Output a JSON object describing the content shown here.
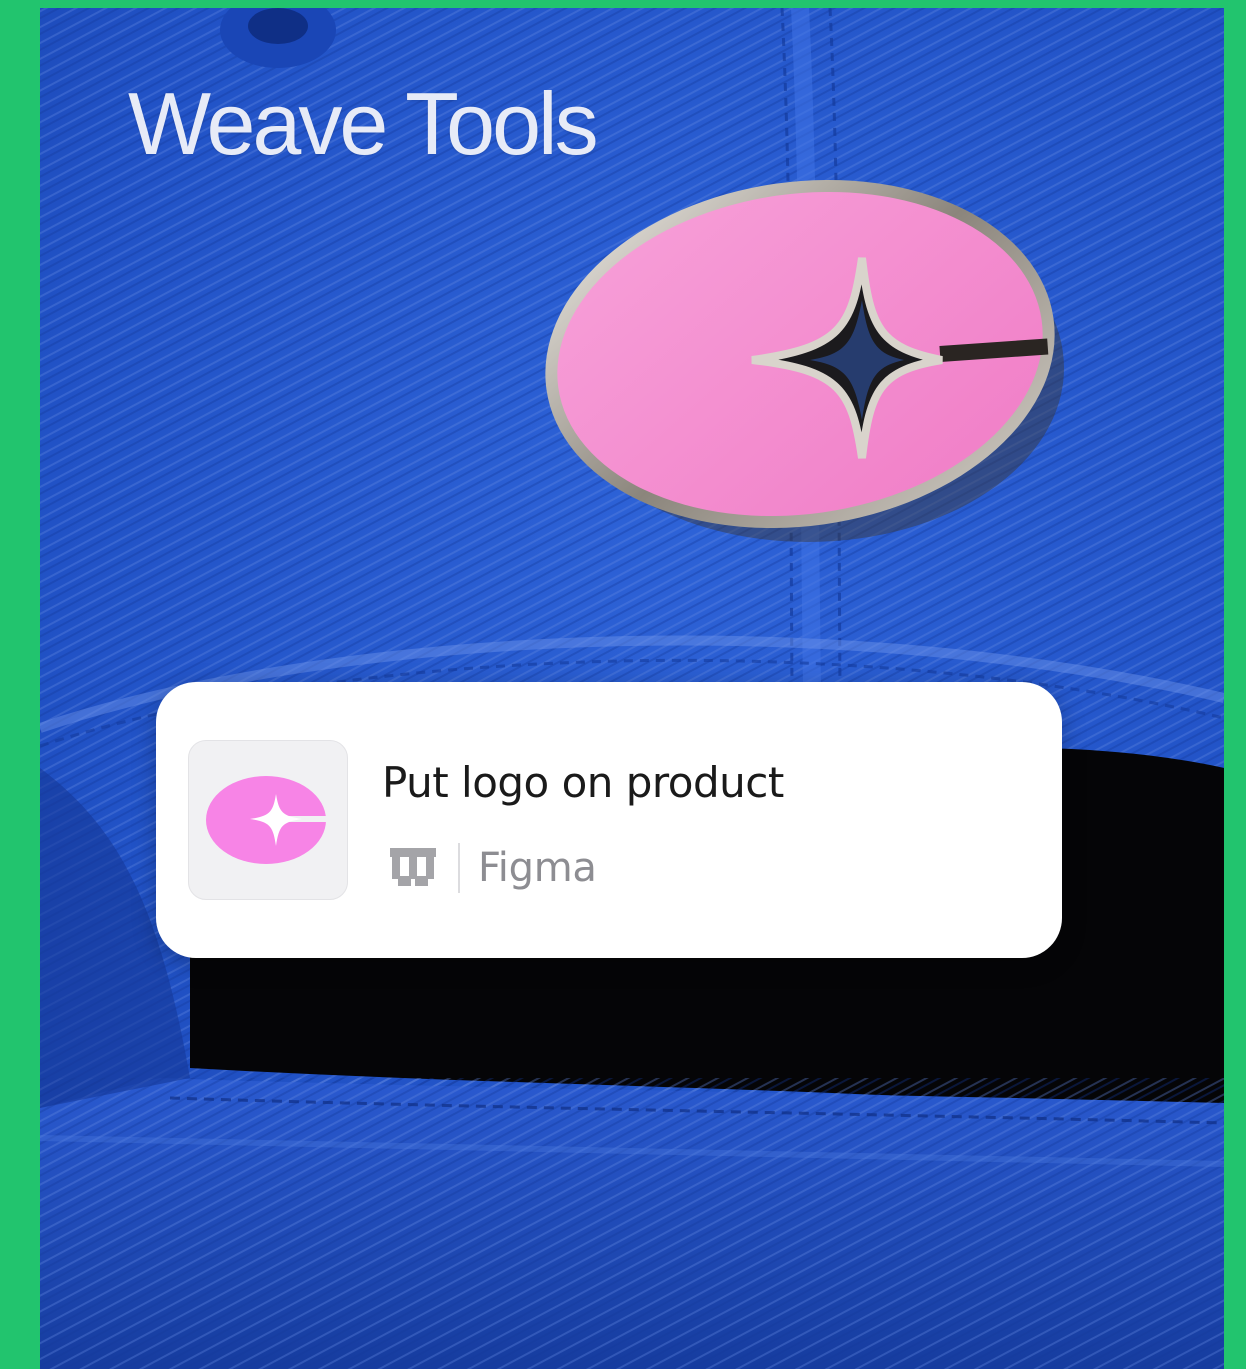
{
  "brand": {
    "title": "Weave Tools"
  },
  "task": {
    "title": "Put logo on product",
    "tool": "Figma",
    "thumbnail_icon": "pink-oval-star-logo-icon",
    "tool_icon": "weave-w-logo-icon"
  },
  "colors": {
    "frame": "#22c46e",
    "denim": "#1f4fc4",
    "pin_pink": "#f58fd0",
    "thumb_pink": "#f784e6",
    "card": "#ffffff",
    "title_text": "#1a1a1a",
    "meta_text": "#8d8d92"
  }
}
